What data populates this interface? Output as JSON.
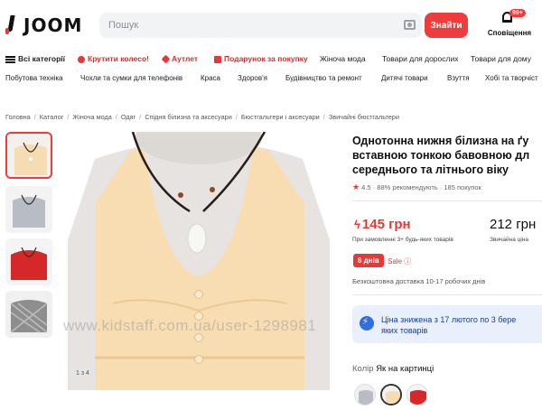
{
  "brand": {
    "name": "JOOM"
  },
  "search": {
    "placeholder": "Пошук",
    "button_label": "Знайти"
  },
  "notifications": {
    "badge": "99+",
    "label": "Сповіщення"
  },
  "nav_primary": [
    {
      "label": "Всі категорії"
    },
    {
      "label": "Крутити колесо!"
    },
    {
      "label": "Аутлет"
    },
    {
      "label": "Подарунок за покупку"
    },
    {
      "label": "Жіноча мода"
    },
    {
      "label": "Товари для дорослих"
    },
    {
      "label": "Товари для дому"
    }
  ],
  "nav_secondary": [
    {
      "label": "Побутова техніка"
    },
    {
      "label": "Чохли та сумки для телефонів"
    },
    {
      "label": "Краса"
    },
    {
      "label": "Здоров'я"
    },
    {
      "label": "Будівництво та ремонт"
    },
    {
      "label": "Дитячі товари"
    },
    {
      "label": "Взуття"
    },
    {
      "label": "Хобі та творчіст"
    }
  ],
  "breadcrumb": [
    "Головна",
    "Каталог",
    "Жіноча мода",
    "Одяг",
    "Спідня білизна та аксесуари",
    "Бюстгальтери і аксесуари",
    "Звичайні бюстгальтери"
  ],
  "gallery": {
    "counter": "1 з 4"
  },
  "watermark": "www.kidstaff.com.ua/user-1298981",
  "product": {
    "title_lines": [
      "Однотонна нижня білизна на ґу",
      "вставною тонкою бавовною дл",
      "середнього та літнього віку"
    ],
    "rating": "4.5",
    "recommend": "88% рекомендують",
    "purchases": "185 покупок",
    "price_promo": "145 грн",
    "price_promo_note": "При замовленні 3+ будь-яких товарів",
    "price_regular": "212 грн",
    "price_regular_note": "Звичайна ціна",
    "days_badge": "8 днів",
    "sale_label": "Sale",
    "delivery": "Безкоштовна доставка 10-17 робочих днів",
    "info_lines": [
      "Ціна знижена з 17 лютого по 3 бере",
      "яких товарів"
    ],
    "color_key": "Колір",
    "color_value": "Як на картинці"
  },
  "colors": {
    "accent": "#ef3b3b",
    "info_bg": "#e9f0fb",
    "info_text": "#1a3d8f"
  }
}
